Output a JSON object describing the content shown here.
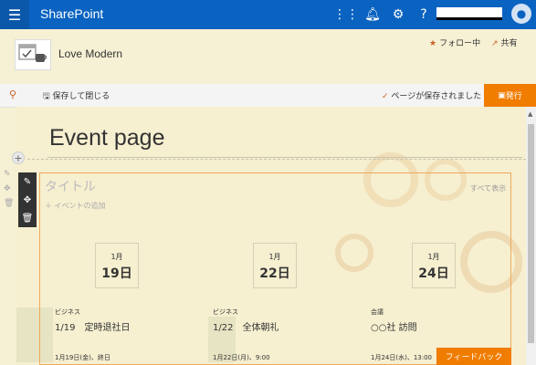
{
  "suitebar": {
    "brand": "SharePoint",
    "icons": [
      "waffle-icon",
      "app-grid-icon",
      "bell-icon",
      "gear-icon",
      "help-icon",
      "avatar-icon"
    ]
  },
  "site": {
    "title": "Love Modern",
    "follow_label": "フォロー中",
    "share_label": "共有"
  },
  "commandbar": {
    "save_close": "保存して閉じる",
    "saved_status": "ページが保存されました",
    "publish": "発行"
  },
  "page": {
    "title": "Event page"
  },
  "webpart": {
    "title": "タイトル",
    "see_all": "すべて表示",
    "add_event": "＋ イベントの追加",
    "events": [
      {
        "month": "1月",
        "day": "19日",
        "category": "ビジネス",
        "date": "1/19",
        "title": "定時退社日",
        "time": "1月19日(金)、終日"
      },
      {
        "month": "1月",
        "day": "22日",
        "category": "ビジネス",
        "date": "1/22",
        "title": "全体朝礼",
        "time": "1月22日(月)、9:00"
      },
      {
        "month": "1月",
        "day": "24日",
        "category": "会議",
        "date": "",
        "title": "○○社 訪問",
        "time": "1月24日(水)、13:00"
      }
    ]
  },
  "feedback": "フィードバック",
  "colors": {
    "suitebar": "#0a63c1",
    "accent": "#f07c00",
    "background": "#f6f0d4"
  }
}
